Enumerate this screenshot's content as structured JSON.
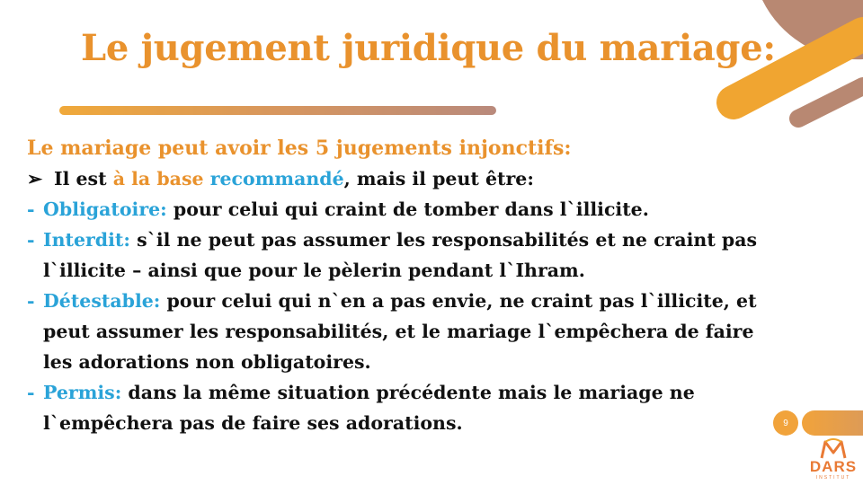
{
  "slide": {
    "title": "Le jugement juridique du mariage:",
    "page_number": "9"
  },
  "content": {
    "subtitle": "Le mariage peut avoir les 5 jugements injonctifs:",
    "intro": {
      "bullet": "➢",
      "before": "Il est ",
      "orange": "à la base",
      "space": " ",
      "blue": "recommandé",
      "after": ", mais il peut être:"
    },
    "items": [
      {
        "dash": "-",
        "term": "Obligatoire:",
        "lines": [
          " pour celui qui craint de tomber dans l`illicite."
        ]
      },
      {
        "dash": "-",
        "term": "Interdit:",
        "lines": [
          " s`il ne peut pas assumer les responsabilités et ne craint pas",
          "l`illicite – ainsi que pour le pèlerin pendant l`Ihram."
        ]
      },
      {
        "dash": "-",
        "term": "Détestable:",
        "lines": [
          " pour celui qui n`en a pas envie, ne craint pas l`illicite, et",
          "peut assumer les responsabilités, et le mariage l`empêchera de faire",
          "les adorations non obligatoires."
        ]
      },
      {
        "dash": "-",
        "term": "Permis:",
        "lines": [
          " dans la même situation précédente mais le mariage ne",
          "l`empêchera pas de faire ses adorations."
        ]
      }
    ]
  },
  "logo": {
    "name": "DARS",
    "tagline": "INSTITUT"
  },
  "colors": {
    "accent_orange": "#e9922d",
    "accent_blue": "#2aa3d8",
    "decor_brown": "#b88872"
  }
}
